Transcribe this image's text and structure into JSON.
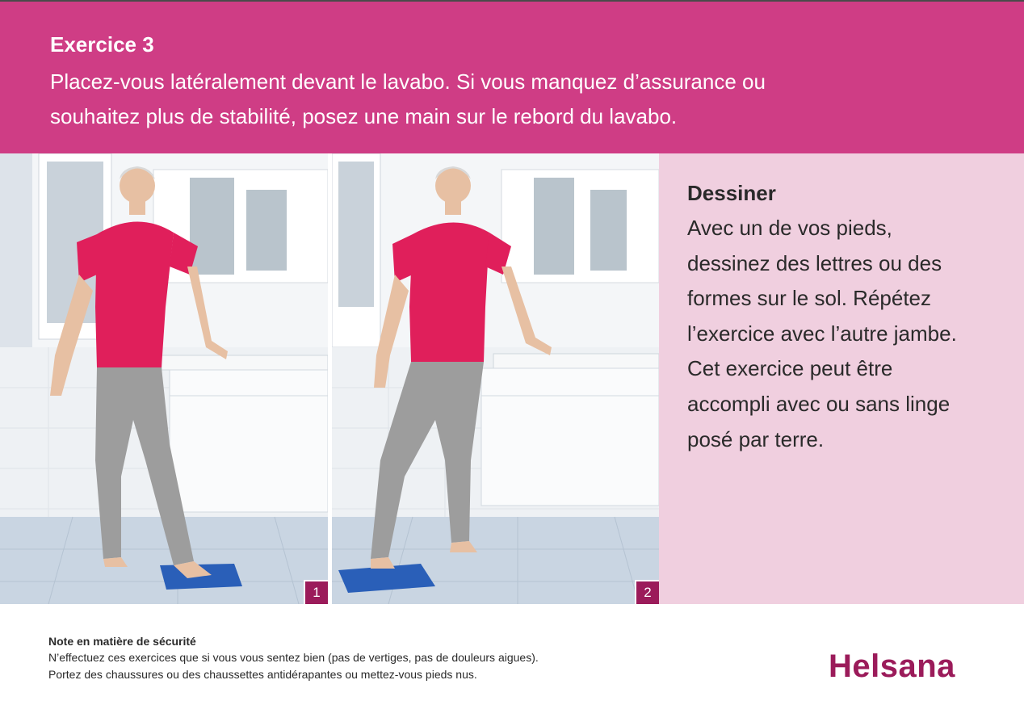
{
  "header": {
    "title": "Exercice 3",
    "intro_line1": "Placez-vous latéralement devant le lavabo. Si vous manquez d’assurance ou",
    "intro_line2": "souhaitez plus de stabilité, posez une main sur le rebord du lavabo."
  },
  "photos": [
    {
      "number": "1"
    },
    {
      "number": "2"
    }
  ],
  "exercise": {
    "name": "Dessiner",
    "lines": [
      "Avec un de vos pieds,",
      "dessinez des lettres ou des",
      "formes sur le sol. Répétez",
      "l’exercice avec l’autre jambe.",
      "Cet exercice peut être",
      "accompli avec ou sans linge",
      "posé par terre."
    ]
  },
  "safety": {
    "title": "Note en matière de sécurité",
    "line1": "N’effectuez ces exercices que si vous vous sentez bien (pas de vertiges, pas de douleurs aigues).",
    "line2": "Portez des chaussures ou des chaussettes antidérapantes ou mettez-vous pieds nus."
  },
  "brand": {
    "logo_text": "Helsana",
    "color": "#9b1b5a",
    "header_color": "#cf3d85",
    "panel_color": "#f0cfdf"
  }
}
